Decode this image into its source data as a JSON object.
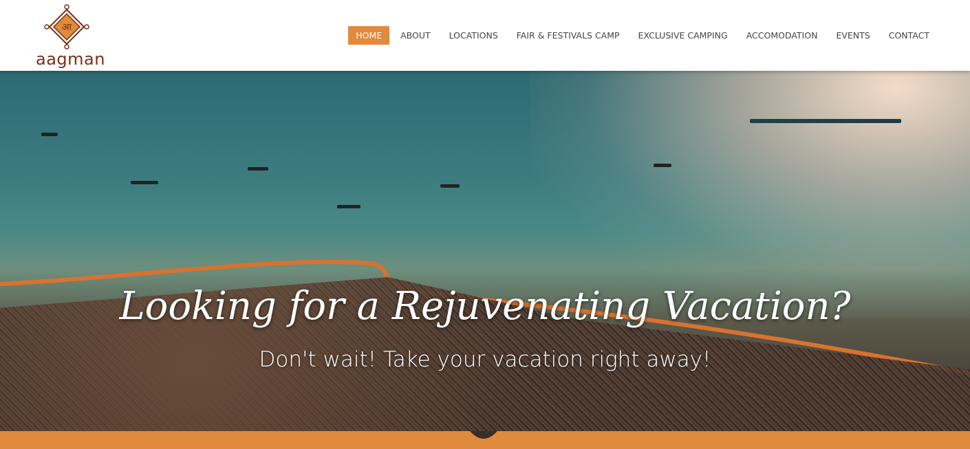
{
  "brand": {
    "logo_glyph": "आ",
    "logo_text": "aagman",
    "colors": {
      "primary": "#e08a3c",
      "logo": "#7a2f14"
    }
  },
  "nav": {
    "items": [
      {
        "label": "HOME",
        "active": true
      },
      {
        "label": "ABOUT"
      },
      {
        "label": "LOCATIONS"
      },
      {
        "label": "FAIR & FESTIVALS CAMP"
      },
      {
        "label": "EXCLUSIVE CAMPING"
      },
      {
        "label": "ACCOMODATION"
      },
      {
        "label": "EVENTS"
      },
      {
        "label": "CONTACT"
      }
    ]
  },
  "hero": {
    "title": "Looking for a Rejuvenating Vacation?",
    "subtitle": "Don't wait! Take your vacation right away!"
  }
}
